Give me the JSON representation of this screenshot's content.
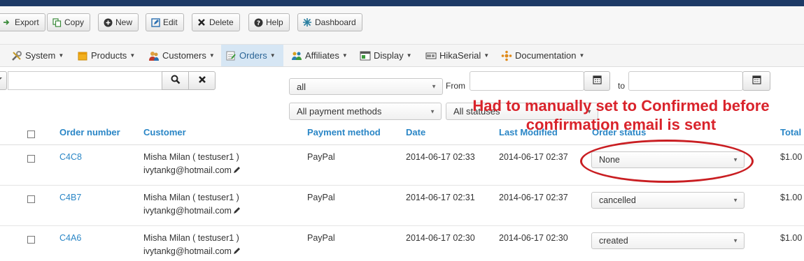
{
  "toolbar": {
    "buttons": [
      {
        "label": "Export",
        "icon": "export-icon"
      },
      {
        "label": "Copy",
        "icon": "copy-icon"
      },
      {
        "label": "New",
        "icon": "plus-circle-icon"
      },
      {
        "label": "Edit",
        "icon": "edit-icon"
      },
      {
        "label": "Delete",
        "icon": "x-icon"
      },
      {
        "label": "Help",
        "icon": "help-circle-icon"
      },
      {
        "label": "Dashboard",
        "icon": "dashboard-icon"
      }
    ]
  },
  "menu": {
    "items": [
      {
        "label": "System",
        "icon": "wrench-icon"
      },
      {
        "label": "Products",
        "icon": "box-icon"
      },
      {
        "label": "Customers",
        "icon": "users-icon"
      },
      {
        "label": "Orders",
        "icon": "orders-icon",
        "active": true
      },
      {
        "label": "Affiliates",
        "icon": "affiliates-icon"
      },
      {
        "label": "Display",
        "icon": "display-icon"
      },
      {
        "label": "HikaSerial",
        "icon": "serial-icon"
      },
      {
        "label": "Documentation",
        "icon": "docs-icon"
      }
    ]
  },
  "filters": {
    "search_value": "",
    "type_select": "all",
    "from_label": "From",
    "to_label": "to",
    "payment_select": "All payment methods",
    "status_select": "All statuses"
  },
  "annotation": {
    "line1": "Had to manually set to Confirmed before",
    "line2": "confirmation email is sent"
  },
  "table": {
    "columns": [
      "Order number",
      "Customer",
      "Payment method",
      "Date",
      "Last Modified",
      "Order status",
      "Total"
    ],
    "rows": [
      {
        "order": "C4C8",
        "customer": "Misha Milan ( testuser1 )",
        "email": "ivytankg@hotmail.com",
        "payment": "PayPal",
        "date": "2014-06-17 02:33",
        "modified": "2014-06-17 02:37",
        "status": "None",
        "total": "$1.00"
      },
      {
        "order": "C4B7",
        "customer": "Misha Milan ( testuser1 )",
        "email": "ivytankg@hotmail.com",
        "payment": "PayPal",
        "date": "2014-06-17 02:31",
        "modified": "2014-06-17 02:37",
        "status": "cancelled",
        "total": "$1.00"
      },
      {
        "order": "C4A6",
        "customer": "Misha Milan ( testuser1 )",
        "email": "ivytankg@hotmail.com",
        "payment": "PayPal",
        "date": "2014-06-17 02:30",
        "modified": "2014-06-17 02:30",
        "status": "created",
        "total": "$1.00"
      }
    ]
  },
  "colors": {
    "header_bar": "#1d3a66",
    "link": "#2a86c6",
    "annotation": "#d9232b",
    "active_menu": "#d6e6f4"
  }
}
